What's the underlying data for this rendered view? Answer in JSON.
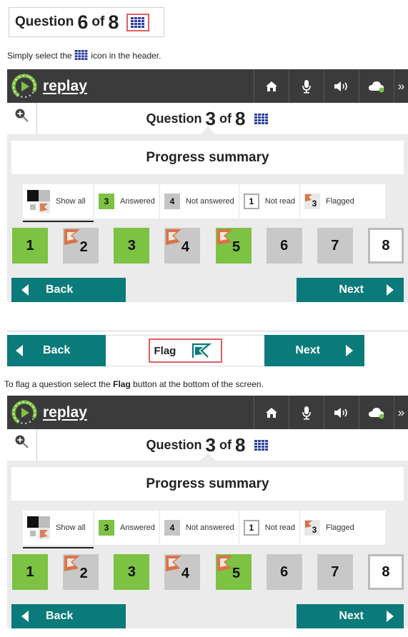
{
  "top_question": {
    "prefix": "Question",
    "number": "6",
    "of": "of",
    "total": "8"
  },
  "instruction_1": {
    "before": "Simply select the",
    "after": "icon in the header."
  },
  "app": {
    "logo_text": "replay",
    "more_label": "»"
  },
  "panel_question": {
    "prefix": "Question",
    "number": "3",
    "of": "of",
    "total": "8"
  },
  "progress_summary_title": "Progress summary",
  "legend": {
    "show_all": "Show all",
    "answered_num": "3",
    "answered": "Answered",
    "not_answered_num": "4",
    "not_answered": "Not answered",
    "not_read_num": "1",
    "not_read": "Not read",
    "flagged_num": "3",
    "flagged": "Flagged"
  },
  "questions": [
    {
      "n": "1",
      "state": "green",
      "flagged": false
    },
    {
      "n": "2",
      "state": "gray",
      "flagged": true
    },
    {
      "n": "3",
      "state": "green",
      "flagged": false
    },
    {
      "n": "4",
      "state": "gray",
      "flagged": true
    },
    {
      "n": "5",
      "state": "green",
      "flagged": true
    },
    {
      "n": "6",
      "state": "gray",
      "flagged": false
    },
    {
      "n": "7",
      "state": "gray",
      "flagged": false
    },
    {
      "n": "8",
      "state": "white",
      "flagged": false
    }
  ],
  "nav": {
    "back": "Back",
    "next": "Next",
    "flag": "Flag"
  },
  "instruction_2": {
    "before": "To flag a question select the",
    "bold": "Flag",
    "after": "button at the bottom of the screen."
  },
  "colors": {
    "teal": "#0b7a7a",
    "green": "#7cc243",
    "gray": "#c8c8c8",
    "highlight": "#e06060",
    "topbar": "#3b3b3b"
  }
}
